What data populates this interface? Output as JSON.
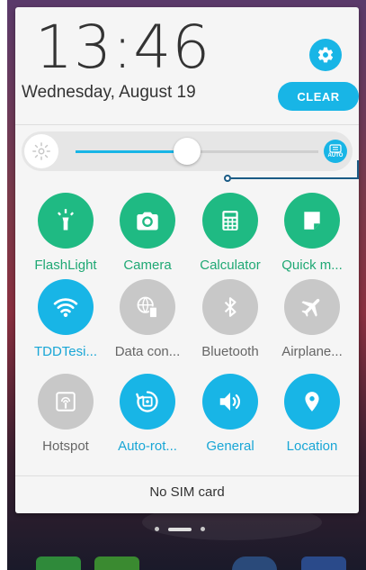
{
  "clock": {
    "time": "13:46",
    "date": "Wednesday, August 19"
  },
  "header": {
    "clear_label": "CLEAR"
  },
  "brightness": {
    "level_percent": 46,
    "auto_label": "AUTO"
  },
  "tiles": [
    {
      "label": "FlashLight",
      "icon": "flashlight-icon",
      "state": "on-green"
    },
    {
      "label": "Camera",
      "icon": "camera-icon",
      "state": "on-green"
    },
    {
      "label": "Calculator",
      "icon": "calculator-icon",
      "state": "on-green"
    },
    {
      "label": "Quick m...",
      "icon": "quick-memo-icon",
      "state": "on-green"
    },
    {
      "label": "TDDTesi...",
      "icon": "wifi-icon",
      "state": "on-blue"
    },
    {
      "label": "Data con...",
      "icon": "mobile-data-icon",
      "state": "off"
    },
    {
      "label": "Bluetooth",
      "icon": "bluetooth-icon",
      "state": "off"
    },
    {
      "label": "Airplane...",
      "icon": "airplane-icon",
      "state": "off"
    },
    {
      "label": "Hotspot",
      "icon": "hotspot-icon",
      "state": "off"
    },
    {
      "label": "Auto-rot...",
      "icon": "auto-rotate-icon",
      "state": "on-blue"
    },
    {
      "label": "General",
      "icon": "sound-icon",
      "state": "on-blue"
    },
    {
      "label": "Location",
      "icon": "location-icon",
      "state": "on-blue"
    }
  ],
  "footer": {
    "status": "No SIM card"
  },
  "colors": {
    "accent_blue": "#18b5e6",
    "accent_green": "#1fba83",
    "off_gray": "#c8c8c8"
  }
}
